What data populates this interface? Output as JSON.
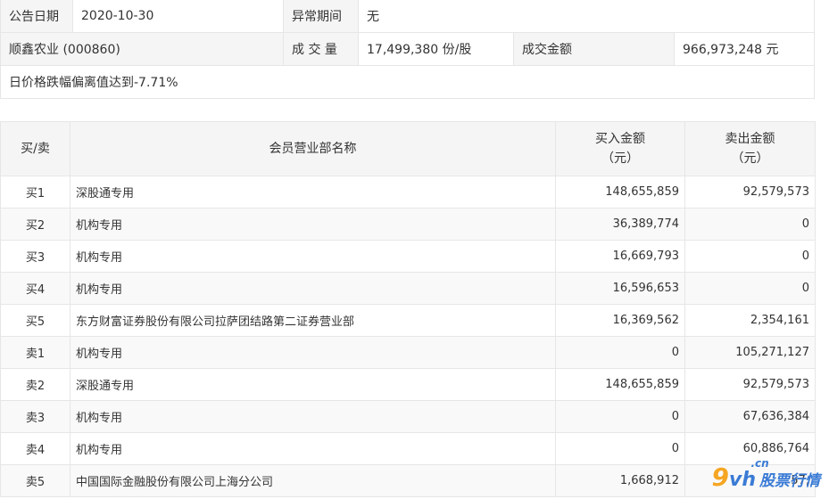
{
  "info": {
    "announce_date_label": "公告日期",
    "announce_date": "2020-10-30",
    "abnormal_period_label": "异常期间",
    "abnormal_period": "无",
    "stock_name": "顺鑫农业 (000860)",
    "volume_label": "成 交 量",
    "volume": "17,499,380 份/股",
    "amount_label": "成交金额",
    "amount": "966,973,248 元",
    "note": "日价格跌幅偏离值达到-7.71%"
  },
  "table": {
    "headers": {
      "side": "买/卖",
      "dept": "会员营业部名称",
      "buy_line1": "买入金额",
      "buy_line2": "（元）",
      "sell_line1": "卖出金额",
      "sell_line2": "（元）"
    },
    "rows": [
      {
        "side": "买1",
        "dept": "深股通专用",
        "buy": "148,655,859",
        "sell": "92,579,573"
      },
      {
        "side": "买2",
        "dept": "机构专用",
        "buy": "36,389,774",
        "sell": "0"
      },
      {
        "side": "买3",
        "dept": "机构专用",
        "buy": "16,669,793",
        "sell": "0"
      },
      {
        "side": "买4",
        "dept": "机构专用",
        "buy": "16,596,653",
        "sell": "0"
      },
      {
        "side": "买5",
        "dept": "东方财富证券股份有限公司拉萨团结路第二证券营业部",
        "buy": "16,369,562",
        "sell": "2,354,161"
      },
      {
        "side": "卖1",
        "dept": "机构专用",
        "buy": "0",
        "sell": "105,271,127"
      },
      {
        "side": "卖2",
        "dept": "深股通专用",
        "buy": "148,655,859",
        "sell": "92,579,573"
      },
      {
        "side": "卖3",
        "dept": "机构专用",
        "buy": "0",
        "sell": "67,636,384"
      },
      {
        "side": "卖4",
        "dept": "机构专用",
        "buy": "0",
        "sell": "60,886,764"
      },
      {
        "side": "卖5",
        "dept": "中国国际金融股份有限公司上海分公司",
        "buy": "1,668,912",
        "sell": "57,"
      }
    ]
  },
  "watermark": {
    "nine": "9",
    "vh": "vh",
    "cn": ".cn",
    "text": "股票行情"
  }
}
